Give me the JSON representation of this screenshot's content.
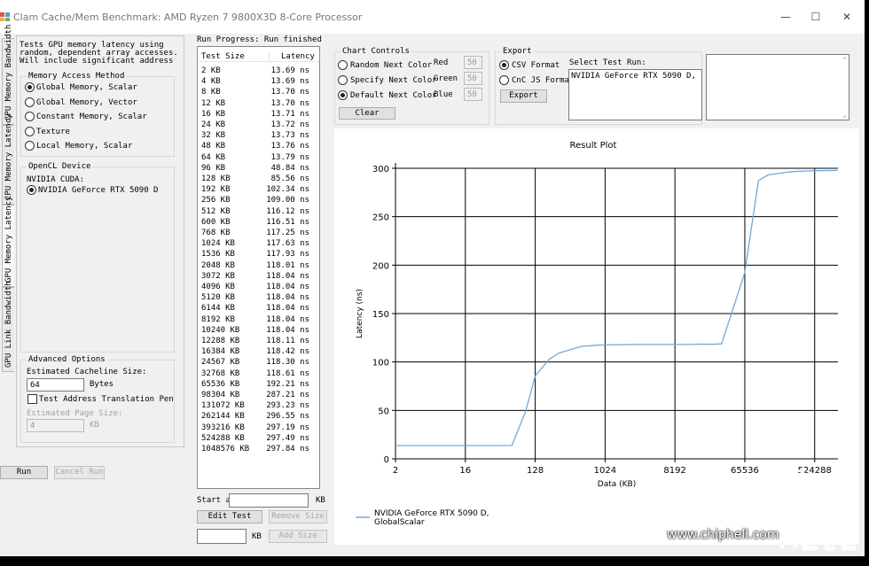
{
  "window": {
    "title": "Clam Cache/Mem Benchmark: AMD Ryzen 7 9800X3D 8-Core Processor",
    "minimize": "—",
    "maximize": "☐",
    "close": "✕"
  },
  "tabs": [
    "CPU Memory Bandwidth",
    "CPU Memory Latency",
    "GPU Memory Latency",
    "GPU Link Bandwidth"
  ],
  "description": [
    "Tests GPU memory latency using",
    "random, dependent array accesses.",
    "Will include significant address"
  ],
  "access_method": {
    "label": "Memory Access Method",
    "options": [
      "Global Memory, Scalar",
      "Global Memory, Vector",
      "Constant Memory, Scalar",
      "Texture",
      "Local Memory, Scalar"
    ],
    "selected": 0
  },
  "opencl": {
    "label": "OpenCL Device",
    "platform": "NVIDIA CUDA:",
    "device": "NVIDIA GeForce RTX 5090 D"
  },
  "advanced": {
    "label": "Advanced Options",
    "cacheline_label": "Estimated Cacheline Size:",
    "cacheline_value": "64",
    "cacheline_unit": "Bytes",
    "translation_label": "Test Address Translation Penalties",
    "page_size_label": "Estimated Page Size:",
    "page_size_value": "4",
    "page_size_unit": "KB"
  },
  "buttons": {
    "run": "Run",
    "cancel": "Cancel Run"
  },
  "progress": "Run Progress: Run finished",
  "results": {
    "col_size": "Test Size",
    "col_latency": "Latency",
    "rows": [
      [
        "2 KB",
        "13.69 ns"
      ],
      [
        "4 KB",
        "13.69 ns"
      ],
      [
        "8 KB",
        "13.70 ns"
      ],
      [
        "12 KB",
        "13.70 ns"
      ],
      [
        "16 KB",
        "13.71 ns"
      ],
      [
        "24 KB",
        "13.72 ns"
      ],
      [
        "32 KB",
        "13.73 ns"
      ],
      [
        "48 KB",
        "13.76 ns"
      ],
      [
        "64 KB",
        "13.79 ns"
      ],
      [
        "96 KB",
        "48.84 ns"
      ],
      [
        "128 KB",
        "85.56 ns"
      ],
      [
        "192 KB",
        "102.34 ns"
      ],
      [
        "256 KB",
        "109.00 ns"
      ],
      [
        "512 KB",
        "116.12 ns"
      ],
      [
        "600 KB",
        "116.51 ns"
      ],
      [
        "768 KB",
        "117.25 ns"
      ],
      [
        "1024 KB",
        "117.63 ns"
      ],
      [
        "1536 KB",
        "117.93 ns"
      ],
      [
        "2048 KB",
        "118.01 ns"
      ],
      [
        "3072 KB",
        "118.04 ns"
      ],
      [
        "4096 KB",
        "118.04 ns"
      ],
      [
        "5120 KB",
        "118.04 ns"
      ],
      [
        "6144 KB",
        "118.04 ns"
      ],
      [
        "8192 KB",
        "118.04 ns"
      ],
      [
        "10240 KB",
        "118.04 ns"
      ],
      [
        "12288 KB",
        "118.11 ns"
      ],
      [
        "16384 KB",
        "118.42 ns"
      ],
      [
        "24567 KB",
        "118.30 ns"
      ],
      [
        "32768 KB",
        "118.61 ns"
      ],
      [
        "65536 KB",
        "192.21 ns"
      ],
      [
        "98304 KB",
        "287.21 ns"
      ],
      [
        "131072 KB",
        "293.23 ns"
      ],
      [
        "262144 KB",
        "296.55 ns"
      ],
      [
        "393216 KB",
        "297.19 ns"
      ],
      [
        "524288 KB",
        "297.49 ns"
      ],
      [
        "1048576 KB",
        "297.84 ns"
      ]
    ]
  },
  "bottom": {
    "start_label": "Start at",
    "start_unit": "KB",
    "edit_test": "Edit Test",
    "remove_size": "Remove Size",
    "add_unit": "KB",
    "add_size": "Add Size"
  },
  "chart_controls": {
    "label": "Chart Controls",
    "options": [
      "Random Next Color",
      "Specify Next Color",
      "Default Next Color"
    ],
    "selected": 2,
    "red_label": "Red",
    "red": "50",
    "green_label": "Green",
    "green": "50",
    "blue_label": "Blue",
    "blue": "50",
    "clear": "Clear"
  },
  "export": {
    "label": "Export",
    "formats": [
      "CSV Format",
      "CnC JS Format"
    ],
    "selected": 0,
    "button": "Export",
    "select_label": "Select Test Run:",
    "run_item": "NVIDIA GeForce RTX 5090 D, GlobalScalar"
  },
  "watermark": "www.chiphell.com",
  "colors": {
    "series": "#6fa8dc",
    "window_bg": "#f0f0f0"
  },
  "chart_data": {
    "type": "line",
    "title": "Result Plot",
    "xlabel": "Data (KB)",
    "ylabel": "Latency (ns)",
    "x_scale": "log2",
    "xlim": [
      2,
      1048576
    ],
    "ylim": [
      0,
      300
    ],
    "x_ticks": [
      2,
      16,
      128,
      1024,
      8192,
      65536,
      524288
    ],
    "x_tick_labels": [
      "2",
      "16",
      "128",
      "1024",
      "8192",
      "65536",
      "524288"
    ],
    "y_ticks": [
      0,
      50,
      100,
      150,
      200,
      250,
      300
    ],
    "grid": true,
    "legend_position": "bottom-left",
    "series": [
      {
        "name": "NVIDIA GeForce RTX 5090 D, GlobalScalar",
        "x": [
          2,
          4,
          8,
          12,
          16,
          24,
          32,
          48,
          64,
          96,
          128,
          192,
          256,
          512,
          600,
          768,
          1024,
          1536,
          2048,
          3072,
          4096,
          5120,
          6144,
          8192,
          10240,
          12288,
          16384,
          24567,
          32768,
          65536,
          98304,
          131072,
          262144,
          393216,
          524288,
          1048576
        ],
        "values": [
          13.69,
          13.69,
          13.7,
          13.7,
          13.71,
          13.72,
          13.73,
          13.76,
          13.79,
          48.84,
          85.56,
          102.34,
          109.0,
          116.12,
          116.51,
          117.25,
          117.63,
          117.93,
          118.01,
          118.04,
          118.04,
          118.04,
          118.04,
          118.04,
          118.04,
          118.11,
          118.42,
          118.3,
          118.61,
          192.21,
          287.21,
          293.23,
          296.55,
          297.19,
          297.49,
          297.84
        ]
      }
    ]
  }
}
